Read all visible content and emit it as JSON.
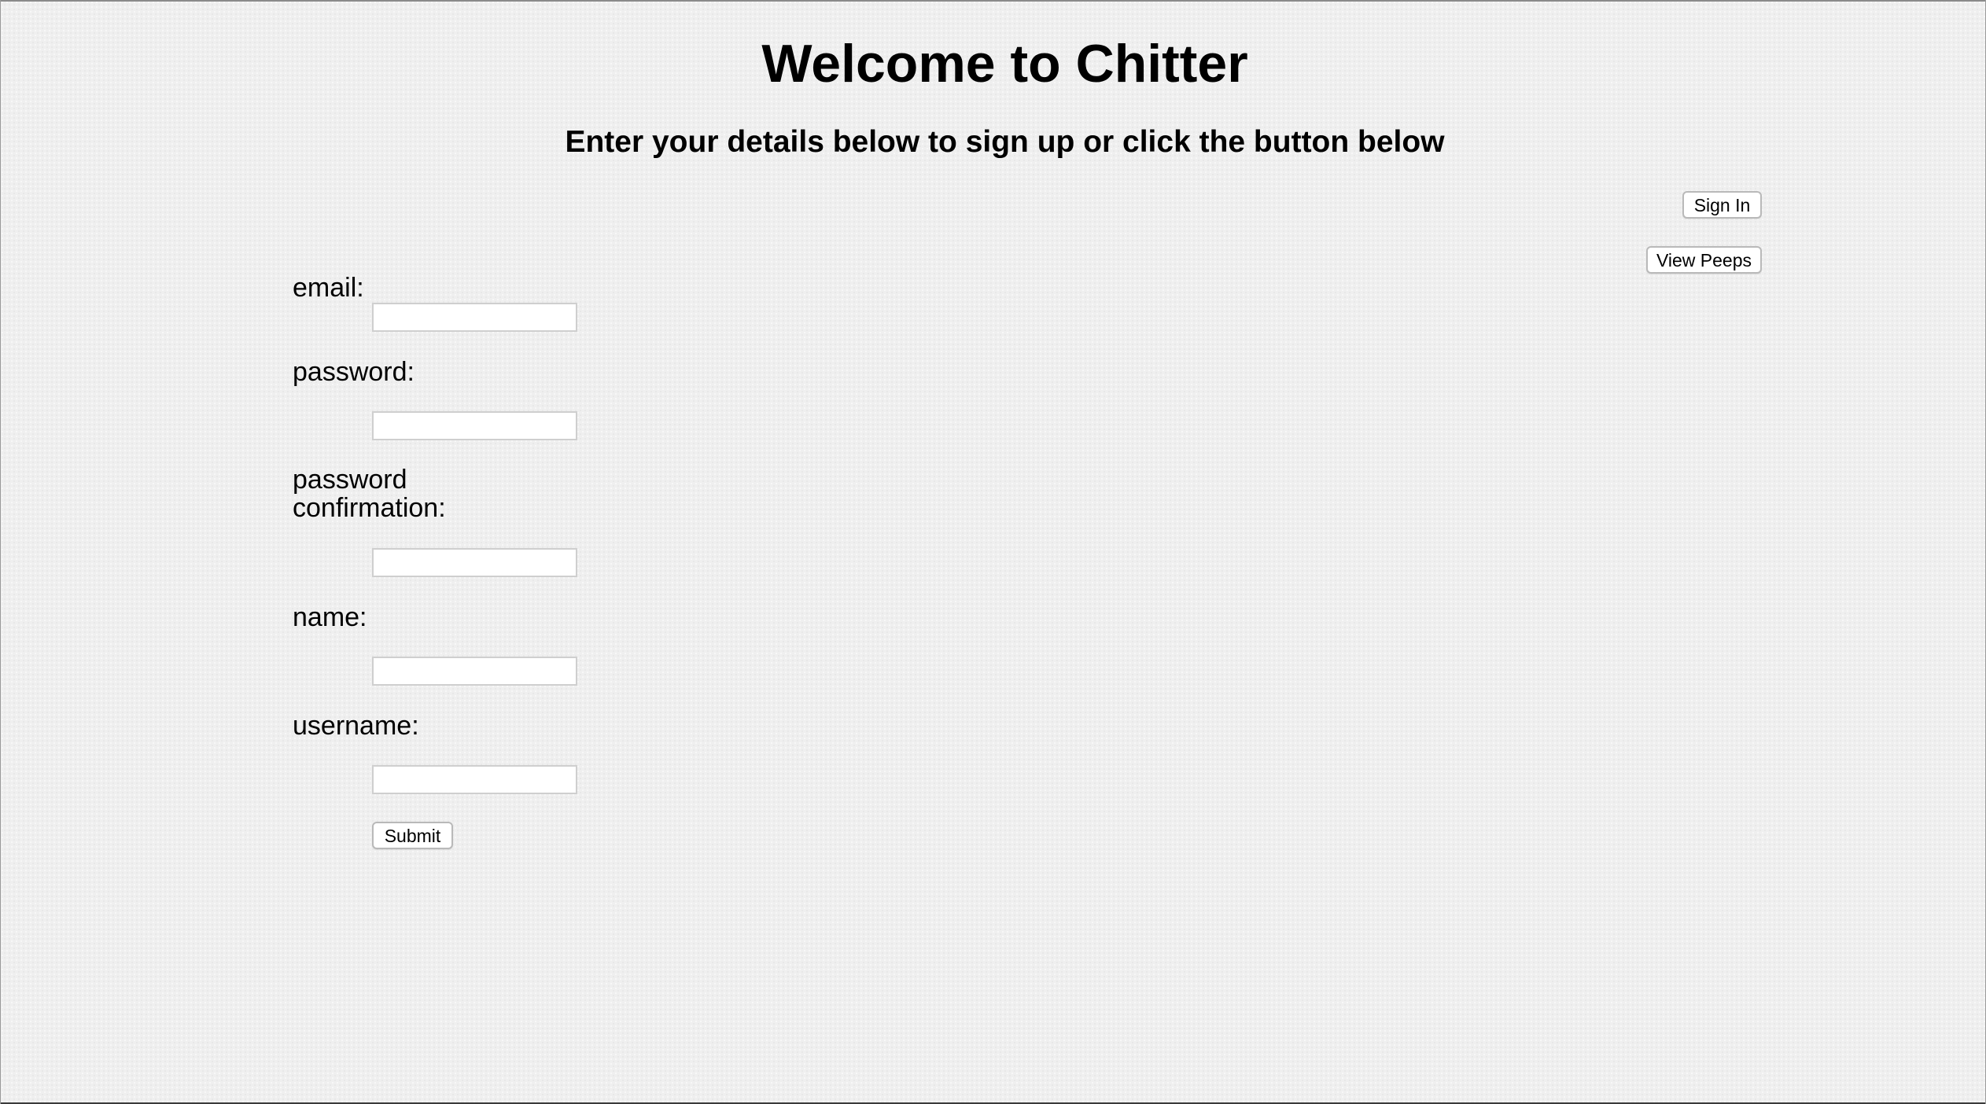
{
  "header": {
    "title": "Welcome to Chitter",
    "subtitle": "Enter your details below to sign up or click the button below"
  },
  "nav": {
    "sign_in_label": "Sign In",
    "view_peeps_label": "View Peeps"
  },
  "form": {
    "email_label": "email:",
    "email_value": "",
    "password_label": "password:",
    "password_value": "",
    "password_confirmation_label": "password confirmation:",
    "password_confirmation_value": "",
    "name_label": "name:",
    "name_value": "",
    "username_label": "username:",
    "username_value": "",
    "submit_label": "Submit"
  }
}
